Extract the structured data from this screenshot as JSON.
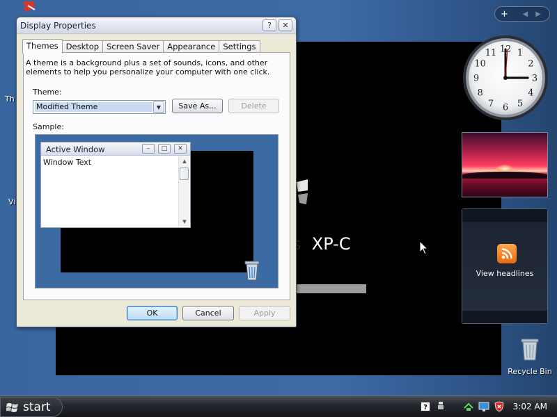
{
  "dialog": {
    "title": "Display Properties",
    "help_label": "?",
    "close_label": "✕",
    "tabs": [
      {
        "label": "Themes",
        "active": true
      },
      {
        "label": "Desktop"
      },
      {
        "label": "Screen Saver"
      },
      {
        "label": "Appearance"
      },
      {
        "label": "Settings"
      }
    ],
    "description": "A theme is a background plus a set of sounds, icons, and other elements to help you personalize your computer with one click.",
    "theme_label": "Theme:",
    "theme_value": "Modified Theme",
    "save_as_label": "Save As...",
    "delete_label": "Delete",
    "sample_label": "Sample:",
    "sample_window": {
      "title": "Active Window",
      "text": "Window Text"
    },
    "ok_label": "OK",
    "cancel_label": "Cancel",
    "apply_label": "Apply"
  },
  "desktop": {
    "left_labels": [
      "Th",
      "Vi"
    ],
    "wallpaper_text": "XP-C",
    "wallpaper_text_ghost": "s",
    "recycle_bin_label": "Recycle Bin"
  },
  "sidebar": {
    "add_label": "+",
    "clock_numerals": [
      "12",
      "1",
      "2",
      "3",
      "4",
      "5",
      "6",
      "7",
      "8",
      "9",
      "10",
      "11"
    ],
    "feed_label": "View headlines"
  },
  "taskbar": {
    "start_label": "start",
    "time": "3:02 AM"
  },
  "colors": {
    "desktop_blue": "#3a66a0",
    "dialog_bg": "#ece9d8",
    "rss_orange": "#f28c28",
    "selected_theme": "#c9daf2"
  }
}
